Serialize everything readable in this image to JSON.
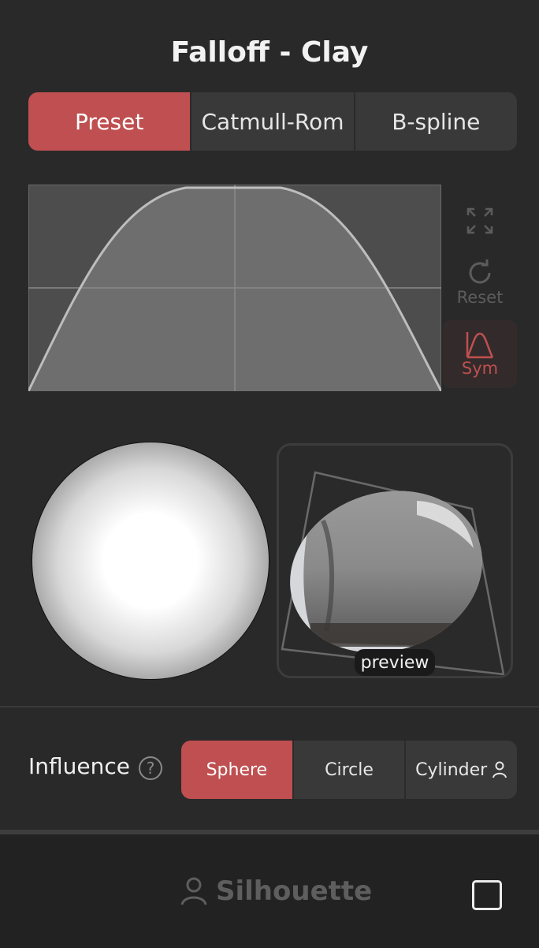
{
  "header": {
    "title": "Falloff - Clay"
  },
  "mode_tabs": [
    {
      "label": "Preset",
      "active": true
    },
    {
      "label": "Catmull-Rom",
      "active": false
    },
    {
      "label": "B-spline",
      "active": false
    }
  ],
  "curve_tools": {
    "expand_icon": "expand-icon",
    "reset_label": "Reset",
    "sym_label": "Sym"
  },
  "preview": {
    "label": "preview"
  },
  "influence": {
    "label": "Influence",
    "help_glyph": "?",
    "options": [
      {
        "label": "Sphere",
        "active": true
      },
      {
        "label": "Circle",
        "active": false
      },
      {
        "label": "Cylinder",
        "active": false
      }
    ]
  },
  "footer": {
    "silhouette_label": "Silhouette",
    "checkbox_checked": false
  },
  "colors": {
    "accent": "#bf4f50",
    "background": "#2a2929",
    "panel": "#3a3939"
  }
}
